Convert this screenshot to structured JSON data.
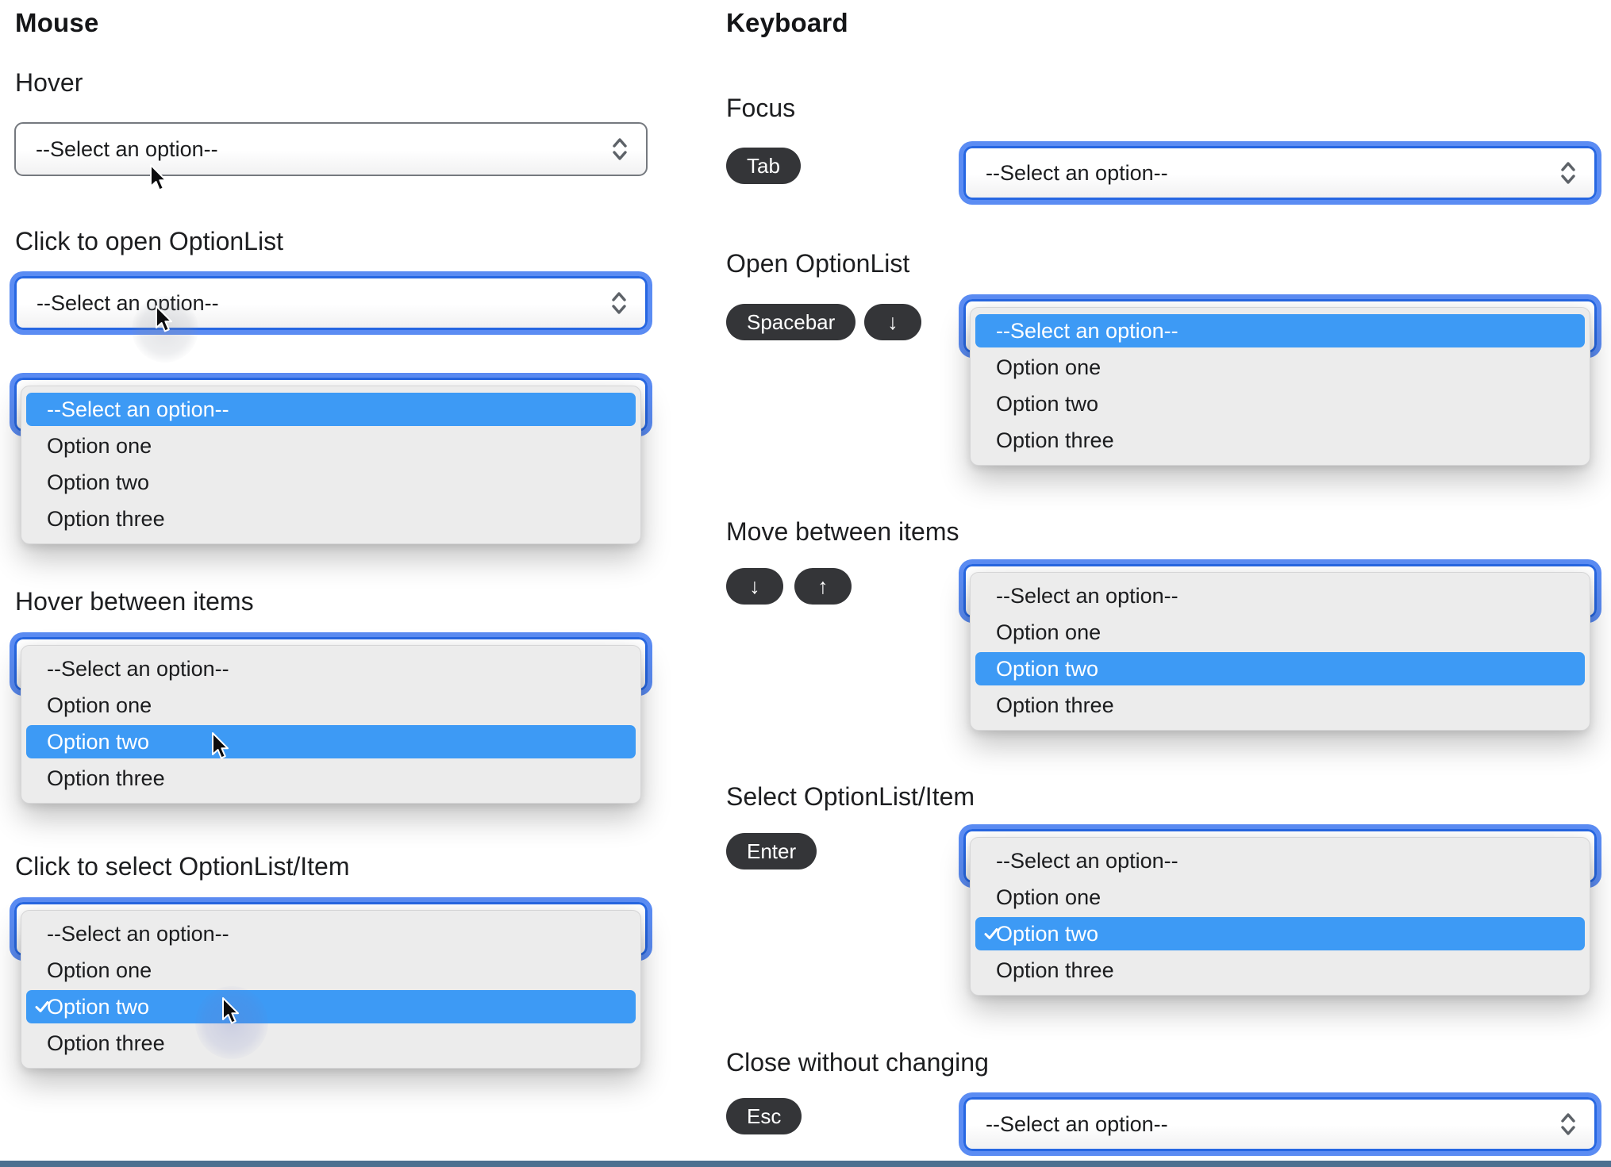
{
  "optionlist": {
    "placeholder": "--Select an option--",
    "options": [
      "--Select an option--",
      "Option one",
      "Option two",
      "Option three"
    ]
  },
  "mouse": {
    "title": "Mouse",
    "sections": {
      "hover": {
        "label": "Hover"
      },
      "click_open": {
        "label": "Click to open OptionList"
      },
      "hover_items": {
        "label": "Hover between items"
      },
      "click_select": {
        "label": "Click to select OptionList/Item"
      }
    }
  },
  "keyboard": {
    "title": "Keyboard",
    "sections": {
      "focus": {
        "label": "Focus",
        "keys": [
          "Tab"
        ]
      },
      "open": {
        "label": "Open OptionList",
        "keys": [
          "Spacebar",
          "↓"
        ]
      },
      "move": {
        "label": "Move between items",
        "keys": [
          "↓",
          "↑"
        ]
      },
      "select": {
        "label": "Select OptionList/Item",
        "keys": [
          "Enter"
        ]
      },
      "close": {
        "label": "Close without changing",
        "keys": [
          "Esc"
        ]
      }
    }
  },
  "colors": {
    "focus_ring": "#5b8cf3",
    "focus_border": "#2767e2",
    "option_highlight": "#3d9af5",
    "panel_background": "#ececec",
    "select_border": "#75797f",
    "key_pill": "#343538",
    "text": "#1b1c1e",
    "footer_bar": "#4d7090"
  }
}
